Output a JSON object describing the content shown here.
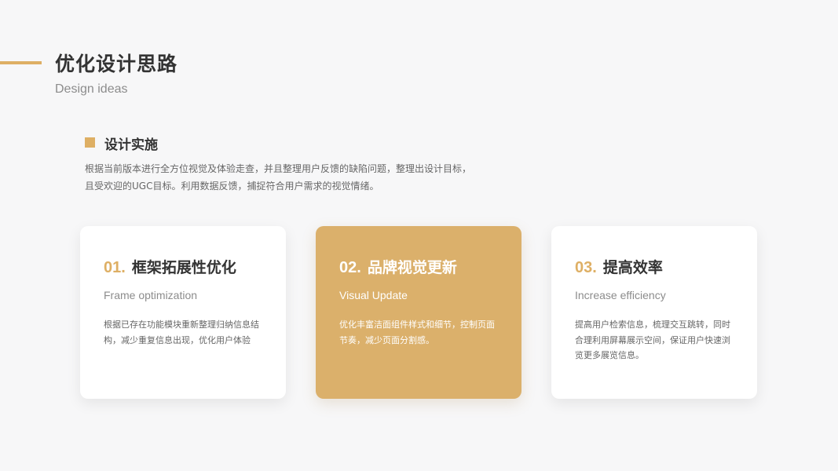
{
  "header": {
    "title": "优化设计思路",
    "subtitle": "Design ideas"
  },
  "section": {
    "heading": "设计实施",
    "description_lines": [
      "根据当前版本进行全方位视觉及体验走查，并且整理用户反馈的缺陷问题，整理出设计目标，",
      "且受欢迎的UGC目标。利用数据反馈，捕捉符合用户需求的视觉情绪。"
    ]
  },
  "cards": [
    {
      "number": "01.",
      "title": "框架拓展性优化",
      "subtitle": "Frame optimization",
      "body_lines": [
        "根据已存在功能模块重新整理归纳信息结",
        "构，减少重复信息出现，优化用户体验"
      ]
    },
    {
      "number": "02.",
      "title": "品牌视觉更新",
      "subtitle": "Visual Update",
      "body_lines": [
        "优化丰富洁面组件样式和细节，控制页面",
        "节奏，减少页面分割感。"
      ]
    },
    {
      "number": "03.",
      "title": "提高效率",
      "subtitle": "Increase efficiency",
      "body_lines": [
        "提高用户检索信息，梳理交互跳转，同时",
        "合理利用屏幕展示空间，保证用户快速浏",
        "览更多展览信息。"
      ]
    }
  ],
  "colors": {
    "accent": "#deaf64",
    "highlight_card": "#dbb06b",
    "background": "#f7f7f8"
  }
}
